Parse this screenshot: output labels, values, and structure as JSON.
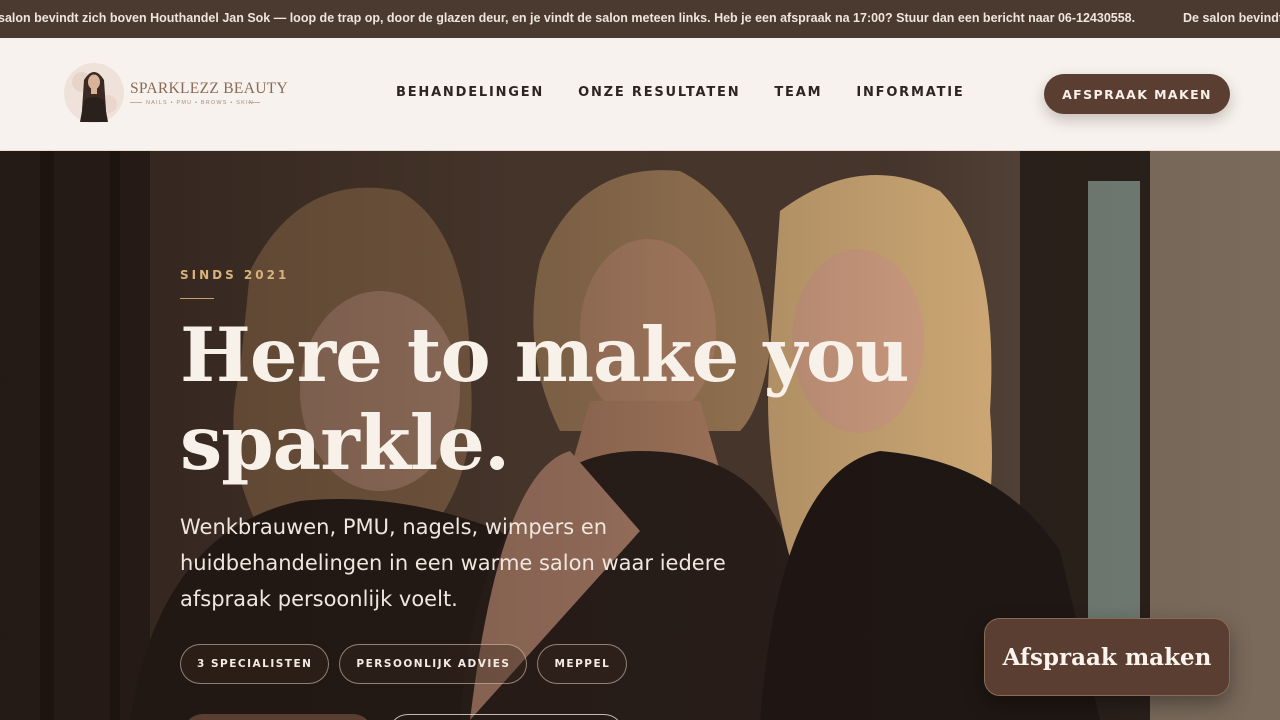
{
  "announcement": {
    "text": "salon bevindt zich boven Houthandel Jan Sok — loop de trap op, door de glazen deur, en je vindt de salon meteen links. Heb je een afspraak na 17:00? Stuur dan een bericht naar 06-12430558.",
    "text_repeat": "De salon bevindt"
  },
  "brand": {
    "name": "SPARKLEZZ BEAUTY",
    "tagline": "NAILS • PMU • BROWS • SKIN"
  },
  "nav": {
    "items": [
      "BEHANDELINGEN",
      "ONZE RESULTATEN",
      "TEAM",
      "INFORMATIE"
    ]
  },
  "header_cta": "AFSPRAAK MAKEN",
  "hero": {
    "eyebrow": "SINDS 2021",
    "headline": "Here to make you sparkle.",
    "subtext": "Wenkbrauwen, PMU, nagels, wimpers en huidbehandelingen in een warme salon waar iedere afspraak persoonlijk voelt.",
    "pills": [
      "3 SPECIALISTEN",
      "PERSOONLIJK ADVIES",
      "MEPPEL"
    ]
  },
  "floating_cta": "Afspraak maken",
  "colors": {
    "brand_brown": "#5a3e32",
    "announcement_bg": "#4a3a30",
    "header_bg": "#f7f2ed",
    "accent_gold": "#d8b27a"
  }
}
